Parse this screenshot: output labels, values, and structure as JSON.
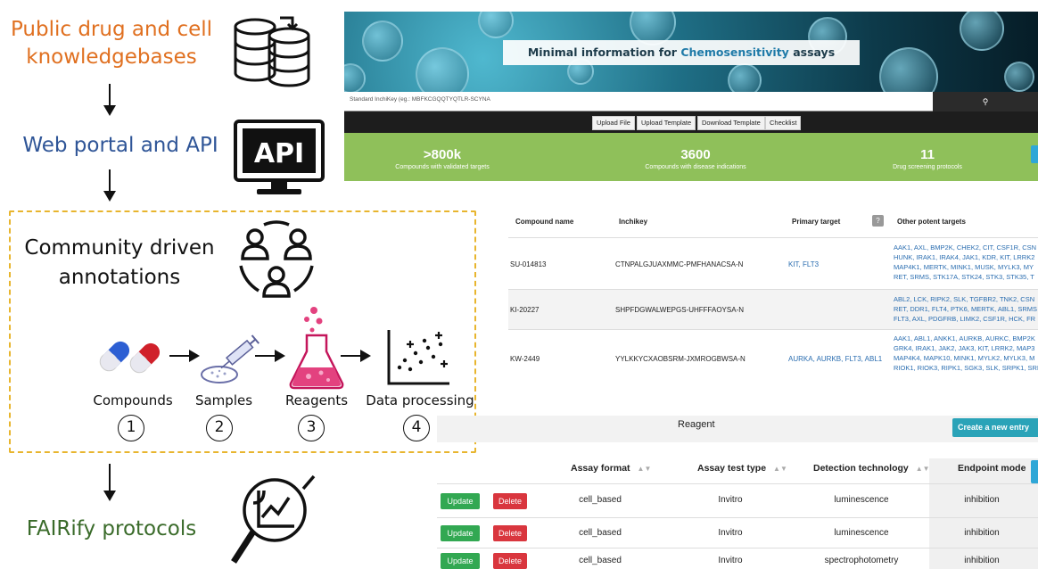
{
  "workflow": {
    "knowledgebases": "Public drug and cell knowledgebases",
    "web_portal": "Web portal and API",
    "api_icon_text": "API",
    "community": "Community driven annotations",
    "fairify": "FAIRify protocols",
    "colors": {
      "knowledgebases": "#e07020",
      "web_portal": "#2f5597",
      "fairify": "#3a6b2a",
      "dashed_border": "#e8b52e"
    },
    "icons": [
      "database-icon",
      "api-monitor-icon",
      "community-people-icon",
      "analysis-magnifier-icon",
      "pills-icon",
      "syringe-icon",
      "flask-icon",
      "scatter-plot-icon"
    ],
    "stages": [
      {
        "label": "Compounds",
        "number": "1"
      },
      {
        "label": "Samples",
        "number": "2"
      },
      {
        "label": "Reagents",
        "number": "3"
      },
      {
        "label": "Data processing",
        "number": "4"
      }
    ]
  },
  "portal": {
    "title_pre": "Minimal information for ",
    "title_accent": "Chemosensitivity",
    "title_post": " assays",
    "search_placeholder": "Standard InchiKey (eg.: MBFKCGQQTYQTLR-SCYNA",
    "search_icon": "magnifier-icon",
    "buttons": [
      "Upload File",
      "Upload Template",
      "Download Template",
      "Checklist"
    ],
    "stats": [
      {
        "value": ">800k",
        "label": "Compounds with validated targets"
      },
      {
        "value": "3600",
        "label": "Compounds with disease indications"
      },
      {
        "value": "11",
        "label": "Drug screening protocols"
      }
    ],
    "colors": {
      "stat_band": "#8fc05a",
      "title_accent": "#1f7aa8"
    }
  },
  "compound_table": {
    "headers": {
      "name": "Compound name",
      "inchikey": "Inchikey",
      "primary": "Primary target",
      "help": "?",
      "other": "Other potent targets"
    },
    "rows": [
      {
        "name": "SU-014813",
        "inchikey": "CTNPALGJUAXMMC-PMFHANACSA-N",
        "primary": "KIT, FLT3",
        "other": [
          "AAK1, AXL, BMP2K, CHEK2, CIT, CSF1R, CSN",
          "HUNK, IRAK1, IRAK4, JAK1, KDR, KIT, LRRK2",
          "MAP4K1, MERTK, MINK1, MUSK, MYLK3, MY",
          "RET, SRMS, STK17A, STK24, STK3, STK35, T"
        ]
      },
      {
        "name": "KI-20227",
        "inchikey": "SHPFDGWALWEPGS-UHFFFAOYSA-N",
        "primary": "",
        "other": [
          "ABL2, LCK, RIPK2, SLK, TGFBR2, TNK2, CSN",
          "RET, DDR1, FLT4, PTK6, MERTK, ABL1, SRMS",
          "FLT3, AXL, PDGFRB, LIMK2, CSF1R, HCK, FR"
        ]
      },
      {
        "name": "KW-2449",
        "inchikey": "YYLKKYCXAOBSRM-JXMROGBWSA-N",
        "primary": "AURKA, AURKB, FLT3, ABL1",
        "other": [
          "AAK1, ABL1, ANKK1, AURKB, AURKC, BMP2K",
          "GRK4, IRAK1, JAK2, JAK3, KIT, LRRK2, MAP3",
          "MAP4K4, MAPK10, MINK1, MYLK2, MYLK3, M",
          "RIOK1, RIOK3, RIPK1, SGK3, SLK, SRPK1, SRI"
        ]
      }
    ]
  },
  "reagent_table": {
    "title": "Reagent",
    "create_button": "Create a new entry",
    "headers": [
      "Assay format",
      "Assay test type",
      "Detection technology",
      "Endpoint mode"
    ],
    "update_label": "Update",
    "delete_label": "Delete",
    "rows": [
      {
        "format": "cell_based",
        "test_type": "Invitro",
        "detection": "luminescence",
        "endpoint": "inhibition"
      },
      {
        "format": "cell_based",
        "test_type": "Invitro",
        "detection": "luminescence",
        "endpoint": "inhibition"
      },
      {
        "format": "cell_based",
        "test_type": "Invitro",
        "detection": "spectrophotometry",
        "endpoint": "inhibition"
      }
    ],
    "colors": {
      "update": "#32a852",
      "delete": "#d9363e",
      "create": "#2aa3b8"
    }
  }
}
